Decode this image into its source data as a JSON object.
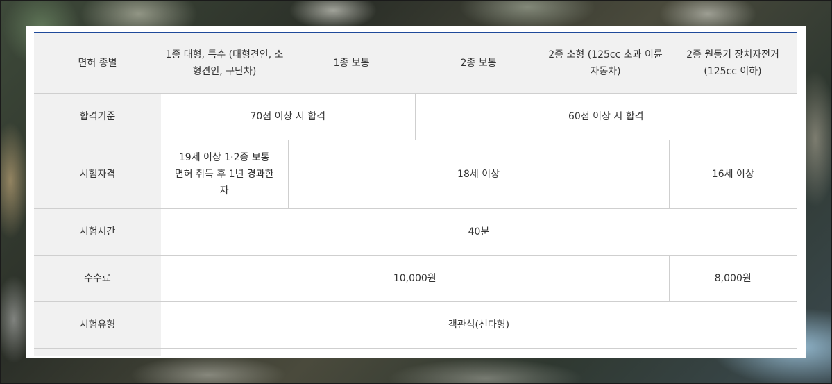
{
  "table": {
    "header": {
      "row_label": "면허 종별",
      "columns": [
        "1종 대형, 특수 (대형견인, 소형견인, 구난차)",
        "1종 보통",
        "2종 보통",
        "2종 소형 (125cc 초과 이륜자동차)",
        "2종 원동기 장치자전거 (125cc 이하)"
      ]
    },
    "rows": {
      "pass": {
        "label": "합격기준",
        "cells": [
          "70점 이상 시 합격",
          "60점 이상 시 합격"
        ]
      },
      "eligibility": {
        "label": "시험자격",
        "cells": [
          "19세 이상 1·2종 보통 면허 취득 후 1년 경과한 자",
          "18세 이상",
          "16세 이상"
        ]
      },
      "duration": {
        "label": "시험시간",
        "cells": [
          "40분"
        ]
      },
      "fee": {
        "label": "수수료",
        "cells": [
          "10,000원",
          "8,000원"
        ]
      },
      "type": {
        "label": "시험유형",
        "cells": [
          "객관식(선다형)"
        ]
      }
    }
  },
  "colors": {
    "accent_border": "#1f4a9a",
    "header_bg": "#f1f1f1",
    "grid_line": "#cfcfcf"
  }
}
